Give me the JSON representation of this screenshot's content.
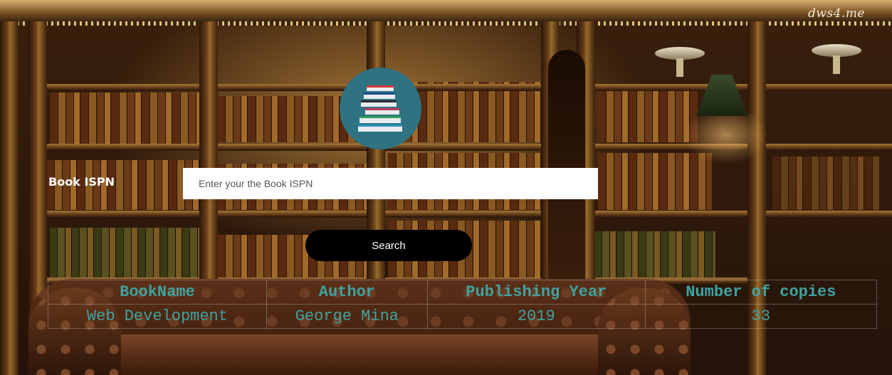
{
  "watermark": "dws4.me",
  "logo": {
    "icon": "book-stack-icon"
  },
  "search": {
    "label": "Book ISPN",
    "placeholder": "Enter your the Book ISPN",
    "value": "",
    "button_label": "Search"
  },
  "results": {
    "columns": [
      "BookName",
      "Author",
      "Publishing Year",
      "Number of copies"
    ],
    "rows": [
      [
        "Web Development",
        "George Mina",
        "2019",
        "33"
      ]
    ]
  },
  "colors": {
    "accent_teal": "#3fa3a0",
    "logo_bg": "#2f7281",
    "button_bg": "#000000"
  }
}
